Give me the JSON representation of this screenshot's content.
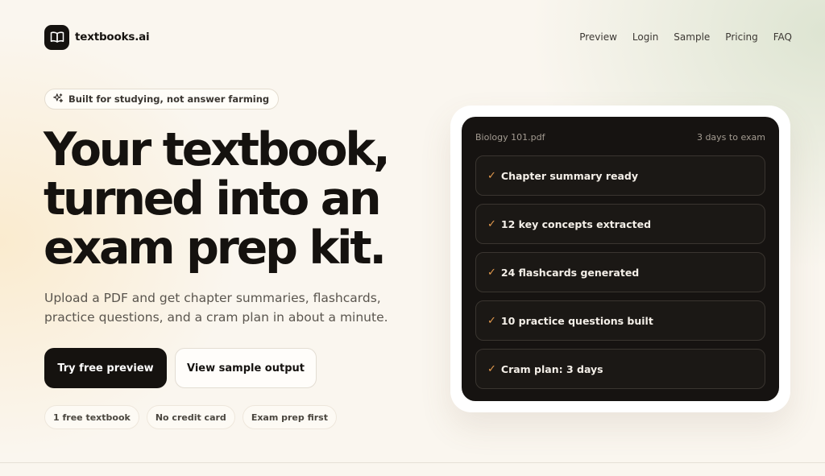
{
  "nav": {
    "brand": "textbooks.ai",
    "logo_icon": "open-book-icon",
    "links": [
      "Preview",
      "Login",
      "Sample",
      "Pricing",
      "FAQ"
    ]
  },
  "badge": {
    "icon": "sparkles-icon",
    "text": "Built for studying, not answer farming"
  },
  "hero": {
    "headline_lines": [
      "Your textbook,",
      "turned into an",
      "exam prep kit."
    ],
    "subtext": "Upload a PDF and get chapter summaries, flashcards, practice questions, and a cram plan in about a minute.",
    "primary_cta": "Try free preview",
    "secondary_cta": "View sample output",
    "pills": [
      "1 free textbook",
      "No credit card",
      "Exam prep first"
    ]
  },
  "preview": {
    "file_name": "Biology 101.pdf",
    "countdown": "3 days to exam",
    "check_glyph": "✓",
    "items": [
      "Chapter summary ready",
      "12 key concepts extracted",
      "24 flashcards generated",
      "10 practice questions built",
      "Cram plan: 3 days"
    ]
  },
  "colors": {
    "accent_check": "#e49a4e",
    "dark": "#15120f",
    "background": "#faf6ef"
  }
}
